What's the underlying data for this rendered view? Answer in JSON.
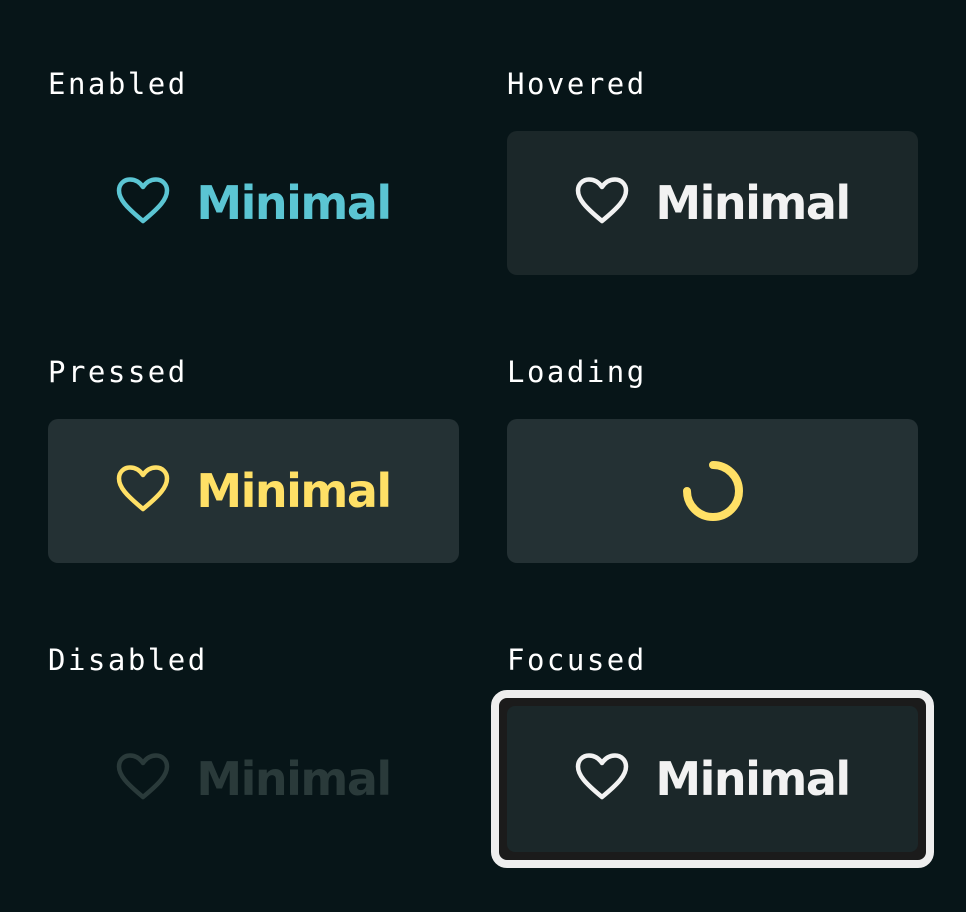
{
  "colors": {
    "background": "#071518",
    "enabled": "#5bc5d3",
    "hovered": "#f2f2f2",
    "pressed": "#ffe066",
    "loading": "#ffe066",
    "disabled": "#2a3a3a",
    "focused": "#f2f2f2",
    "focus_ring": "#eeeeee"
  },
  "states": {
    "enabled": {
      "label": "Enabled",
      "button_text": "Minimal",
      "icon": "heart-icon"
    },
    "hovered": {
      "label": "Hovered",
      "button_text": "Minimal",
      "icon": "heart-icon"
    },
    "pressed": {
      "label": "Pressed",
      "button_text": "Minimal",
      "icon": "heart-icon"
    },
    "loading": {
      "label": "Loading",
      "icon": "loading-spinner-icon"
    },
    "disabled": {
      "label": "Disabled",
      "button_text": "Minimal",
      "icon": "heart-icon"
    },
    "focused": {
      "label": "Focused",
      "button_text": "Minimal",
      "icon": "heart-icon"
    }
  }
}
